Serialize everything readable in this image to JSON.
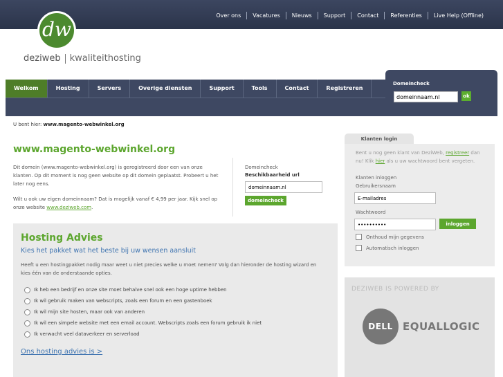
{
  "topnav": [
    "Over ons",
    "Vacatures",
    "Nieuws",
    "Support",
    "Contact",
    "Referenties",
    "Live Help (Offline)"
  ],
  "logo": {
    "mark": "dw",
    "name": "deziweb",
    "tagline": "kwaliteithosting"
  },
  "mainnav": [
    "Welkom",
    "Hosting",
    "Servers",
    "Overige diensten",
    "Support",
    "Tools",
    "Contact",
    "Registreren"
  ],
  "domain_top": {
    "label": "Domeincheck",
    "value": "domeinnaam.nl",
    "button": "ok"
  },
  "breadcrumb": {
    "prefix": "U bent hier:",
    "current": "www.magento-webwinkel.org"
  },
  "page_title": "www.magento-webwinkel.org",
  "intro": {
    "p1": "Dit domein (www.magento-webwinkel.org) is geregistreerd door een van onze klanten. Op dit moment is nog geen website op dit domein geplaatst. Probeert u het later nog eens.",
    "p2_text": "Wilt u ook uw eigen domeinnaam? Dat is mogelijk vanaf € 4,99 per jaar. Kijk snel op onze website",
    "p2_link": "www.deziweb.com",
    "p2_end": "."
  },
  "domcheck": {
    "label": "Domeincheck",
    "sublabel": "Beschikbaarheid url",
    "value": "domeinnaam.nl",
    "button": "domeincheck"
  },
  "advies": {
    "title": "Hosting Advies",
    "subtitle": "Kies het pakket wat het beste bij uw wensen aansluit",
    "description": "Heeft u een hostingpakket nodig maar weet u niet precies welke u moet nemen? Volg dan hieronder de hosting wizard en kies één van de onderstaande opties.",
    "options": [
      "Ik heb een bedrijf en onze site moet behalve snel ook een hoge uptime hebben",
      "Ik wil gebruik maken van webscripts, zoals een forum en een gastenboek",
      "Ik wil mijn site hosten, maar ook van anderen",
      "Ik wil een simpele website met een email account. Webscripts zoals een forum gebruik ik niet",
      "Ik verwacht veel dataverkeer en serverload"
    ],
    "link": "Ons hosting advies is >"
  },
  "login": {
    "tab": "Klanten login",
    "info_a": "Bent u nog geen klant van DeziWeb,",
    "info_link1": "registreer",
    "info_b": "dan nu! Klik",
    "info_link2": "hier",
    "info_c": "als u uw wachtwoord bent vergeten.",
    "label1": "Klanten inloggen",
    "label2": "Gebruikersnaam",
    "user_value": "E-mailadres",
    "label3": "Wachtwoord",
    "pass_value": "••••••••••",
    "button": "inloggen",
    "check1": "Onthoud mijn gegevens",
    "check2": "Automatisch inloggen"
  },
  "powered": {
    "label": "DEZIWEB IS POWERED BY",
    "dell": "DELL",
    "brand": "EQUALLOGIC"
  }
}
